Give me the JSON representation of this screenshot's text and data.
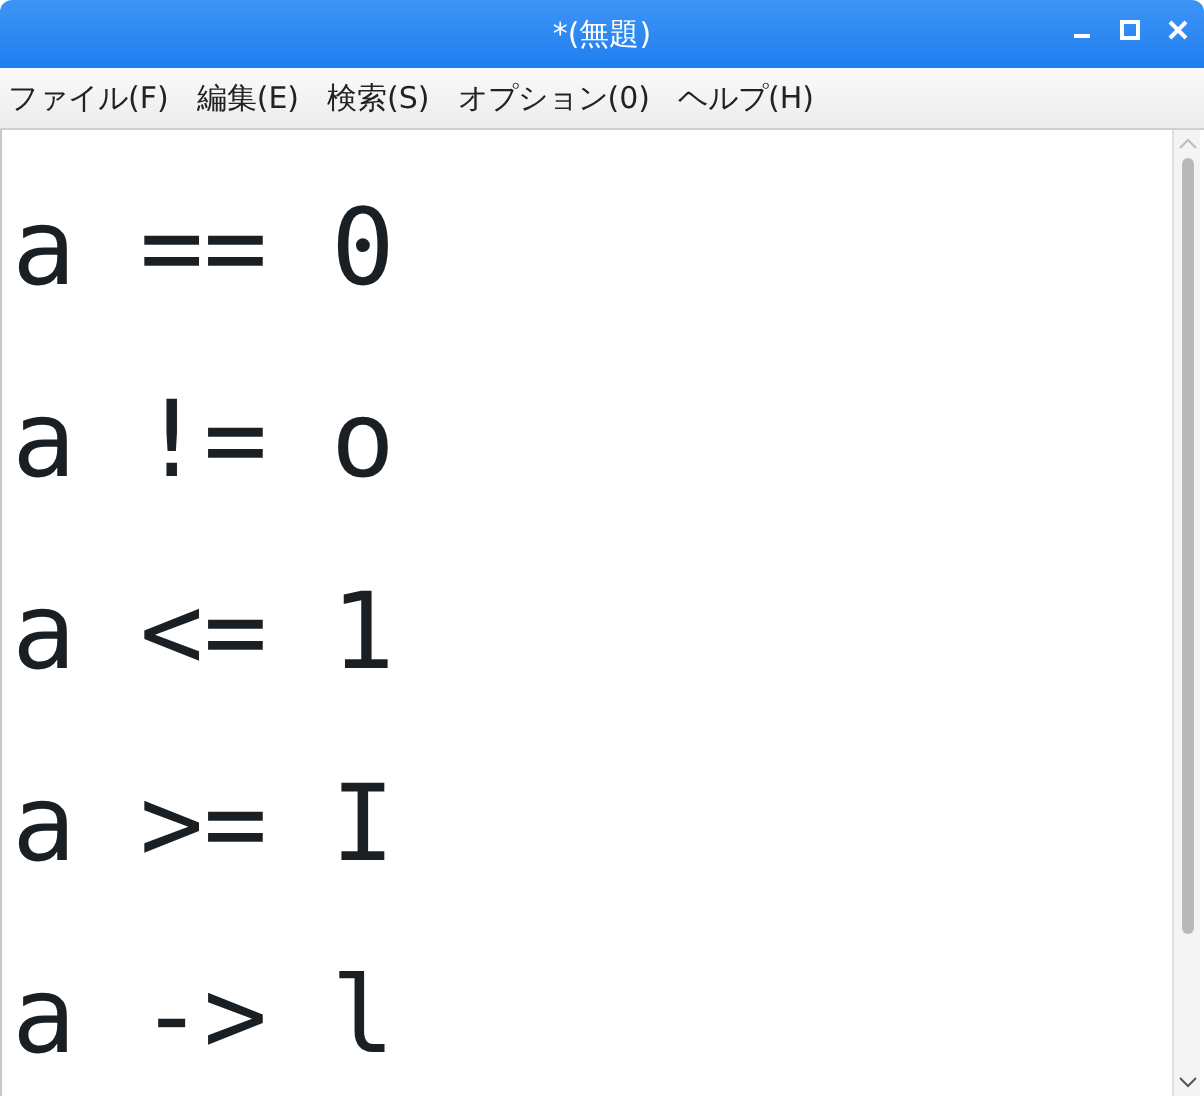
{
  "window": {
    "title": "*(無題)"
  },
  "menu": [
    "ファイル(F)",
    "編集(E)",
    "検索(S)",
    "オプション(0)",
    "ヘルプ(H)"
  ],
  "editor": {
    "lines": [
      "a == 0",
      "a != o",
      "a <= 1",
      "a >= I",
      "a -> l"
    ]
  }
}
